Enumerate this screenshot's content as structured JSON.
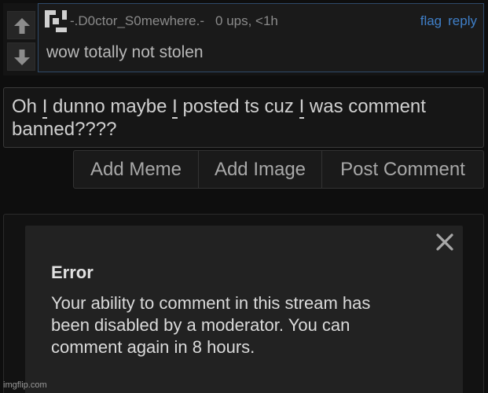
{
  "comment": {
    "username": "-.D0ctor_S0mewhere.-",
    "score": "0 ups, <1h",
    "flag_label": "flag",
    "reply_label": "reply",
    "text": "wow totally not stolen"
  },
  "composer": {
    "text_parts": [
      "Oh ",
      "I",
      " dunno maybe ",
      "I",
      " posted ts cuz ",
      "I",
      " was comment"
    ],
    "text_line2": "banned????",
    "add_meme_label": "Add Meme",
    "add_image_label": "Add Image",
    "post_comment_label": "Post Comment"
  },
  "error_modal": {
    "title": "Error",
    "lines": [
      "Your ability to comment in this stream has",
      "been disabled by a moderator. You can",
      "comment again in 8 hours."
    ]
  },
  "watermark": "imgflip.com",
  "icons": {
    "upvote": "arrow-up-icon",
    "downvote": "arrow-down-icon",
    "avatar": "identicon-avatar",
    "close": "close-icon"
  },
  "colors": {
    "background": "#0e0e0e",
    "link": "#3f7fc8",
    "modal_bg": "#222222",
    "comment_border": "#2f4a6a"
  }
}
